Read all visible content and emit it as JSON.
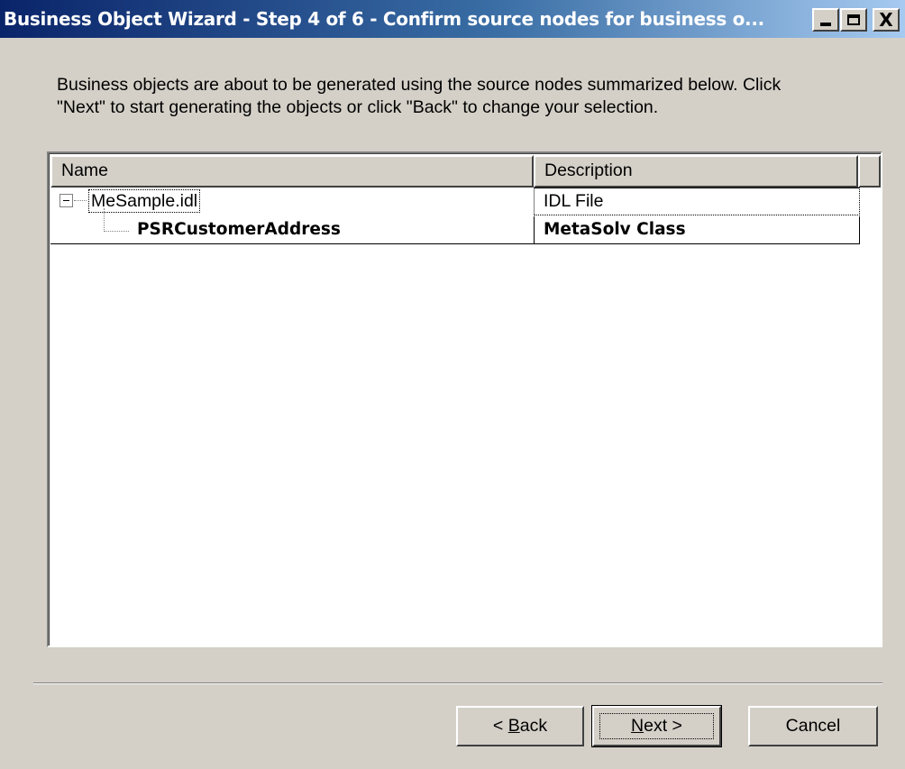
{
  "window": {
    "title": "Business Object Wizard - Step 4 of 6 - Confirm source nodes for business o...",
    "minimize_icon": "minimize-icon",
    "maximize_icon": "maximize-icon",
    "close_glyph": "X"
  },
  "instructions": {
    "line1": "Business objects are about to be generated using the source nodes summarized below. Click",
    "line2": "\"Next\" to start generating the objects or click \"Back\" to change your selection."
  },
  "table": {
    "columns": [
      "Name",
      "Description"
    ],
    "rows": [
      {
        "name": "MeSample.idl",
        "description": "IDL File",
        "expanded": true,
        "expander": "⊟"
      },
      {
        "name": "PSRCustomerAddress",
        "description": "MetaSolv Class",
        "bold": true
      }
    ]
  },
  "buttons": {
    "back_prefix": "< ",
    "back_accel": "B",
    "back_rest": "ack",
    "next_accel": "N",
    "next_rest": "ext >",
    "cancel": "Cancel"
  },
  "colors": {
    "titlebar_start": "#0a246a",
    "titlebar_end": "#a6caf0",
    "face": "#d4d0c8"
  }
}
